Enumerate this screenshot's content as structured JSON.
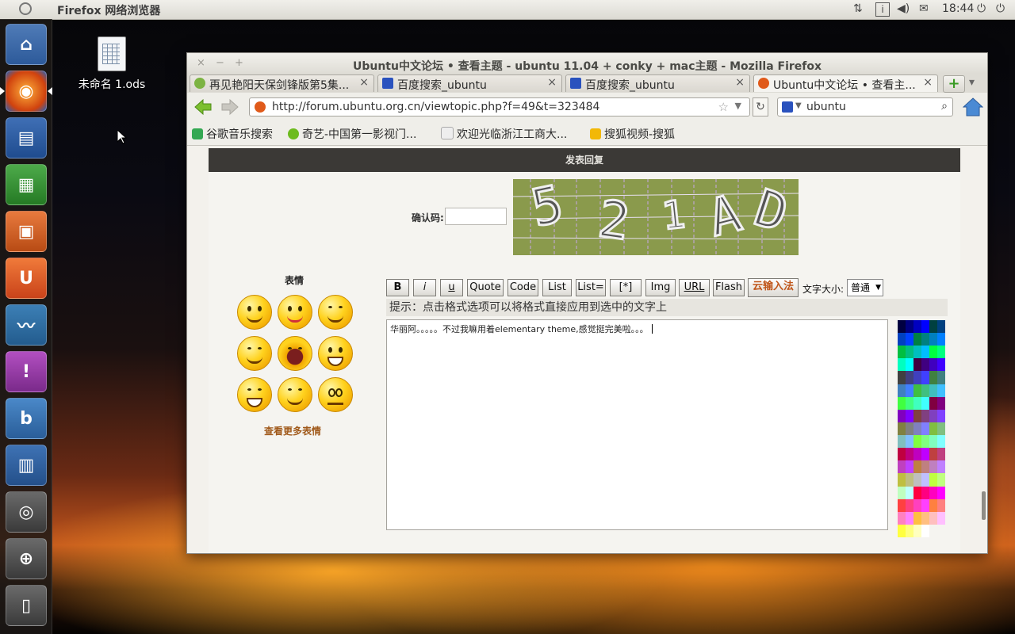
{
  "top_panel": {
    "app_title": "Firefox 网络浏览器",
    "clock": "18:44"
  },
  "desktop": {
    "file_label": "未命名 1.ods"
  },
  "window": {
    "title": "Ubuntu中文论坛 • 查看主题 - ubuntu 11.04 + conky + mac主题 - Mozilla Firefox",
    "close": "×",
    "minimize": "−",
    "maximize": "+"
  },
  "tabs": [
    {
      "label": "再见艳阳天保剑锋版第5集...",
      "close": "×"
    },
    {
      "label": "百度搜索_ubuntu",
      "close": "×"
    },
    {
      "label": "百度搜索_ubuntu",
      "close": "×"
    },
    {
      "label": "Ubuntu中文论坛 • 查看主...",
      "close": "×"
    }
  ],
  "tab_controls": {
    "new_tab": "+",
    "list": "▾"
  },
  "navbar": {
    "url": "http://forum.ubuntu.org.cn/viewtopic.php?f=49&t=323484",
    "search": "ubuntu"
  },
  "bookmarks": [
    {
      "label": "谷歌音乐搜索",
      "color": "#34a853"
    },
    {
      "label": "奇艺-中国第一影视门...",
      "color": "#6dbb1e"
    },
    {
      "label": "欢迎光临浙江工商大...",
      "color": "#dddddd"
    },
    {
      "label": "搜狐视频-搜狐",
      "color": "#f2b807"
    }
  ],
  "reply": {
    "header": "发表回复",
    "captcha_label": "确认码:",
    "captcha_chars": [
      "5",
      "2",
      "1",
      "A",
      "D"
    ]
  },
  "smileys": {
    "title": "表情",
    "more": "查看更多表情"
  },
  "toolbar": {
    "buttons": [
      "B",
      "i",
      "u",
      "Quote",
      "Code",
      "List",
      "List=",
      "[*]",
      "Img",
      "URL",
      "Flash",
      "云输入法"
    ],
    "fontsize_label": "文字大小:",
    "fontsize_value": "普通"
  },
  "editor": {
    "hint": "提示：点击格式选项可以将格式直接应用到选中的文字上",
    "text": "华丽阿。。。。。不过我嘛用着elementary theme,感觉挺完美啦。。。"
  },
  "colors": {
    "launcher_bg": "#1c1816",
    "reply_header_bg": "#3b3936",
    "accent_link": "#a0591a"
  }
}
